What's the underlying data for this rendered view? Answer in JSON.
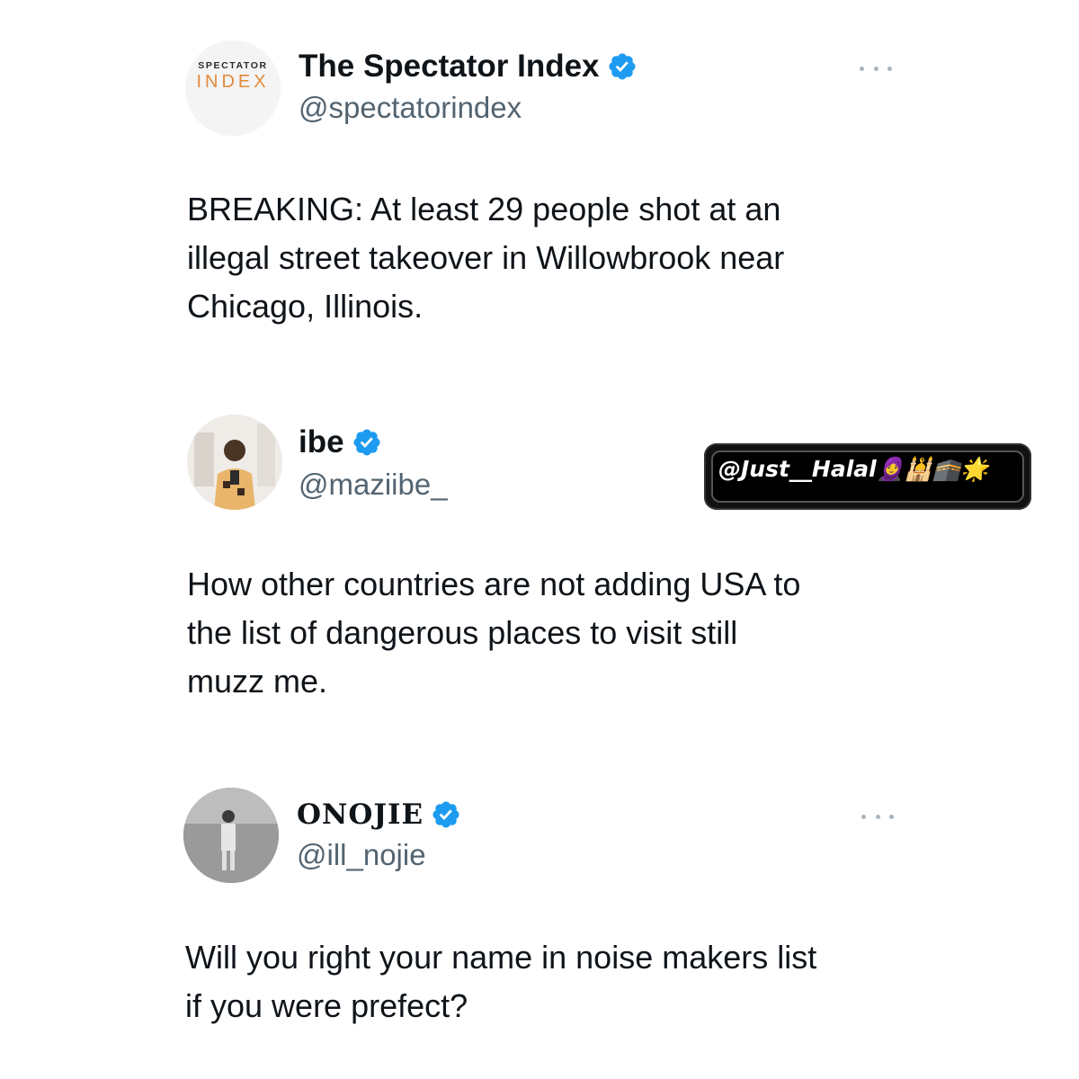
{
  "tweets": [
    {
      "display_name": "The Spectator Index",
      "handle": "@spectatorindex",
      "verified": true,
      "avatar_logo": {
        "line1": "SPECTATOR",
        "line2": "INDEX"
      },
      "text": "BREAKING: At least 29 people shot at an\nillegal street takeover in Willowbrook near\nChicago, Illinois."
    },
    {
      "display_name": "ibe",
      "handle": "@maziibe_",
      "verified": true,
      "text": "How other countries are not adding USA to\nthe list of dangerous places to visit still\nmuzz me."
    },
    {
      "display_name": "ONOJIE",
      "handle": "@ill_nojie",
      "verified": true,
      "text": "Will you right your name in noise makers list\nif you were prefect?"
    }
  ],
  "watermark": {
    "text": "@Just__Halal🧕🕌🕋🌟"
  },
  "icons": {
    "verified": "verified-badge-icon",
    "more": "more-options-icon"
  },
  "colors": {
    "verified_blue": "#1d9bf0",
    "handle_gray": "#536471",
    "logo_orange": "#e08a3c"
  }
}
